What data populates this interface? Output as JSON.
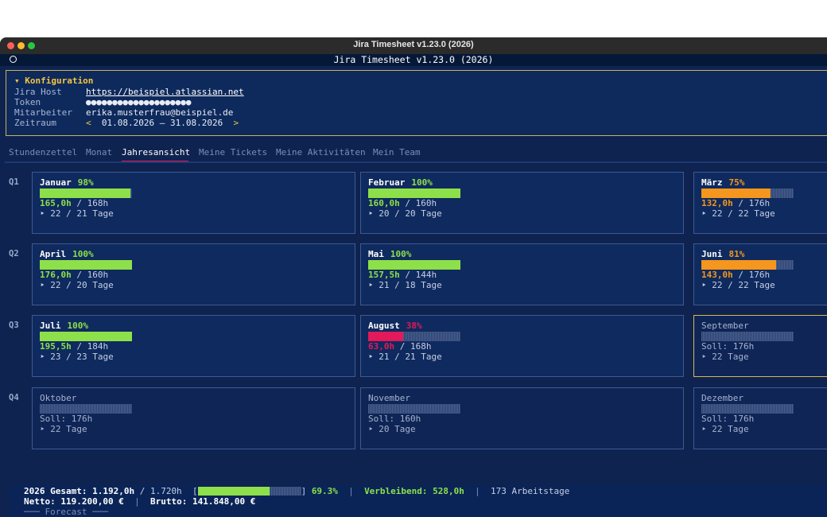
{
  "window": {
    "title": "Jira Timesheet v1.23.0 (2026)"
  },
  "app": {
    "title": "Jira Timesheet v1.23.0 (2026)"
  },
  "config": {
    "heading": "▾ Konfiguration",
    "rows": [
      {
        "label": "Jira Host",
        "value": "https://beispiel.atlassian.net"
      },
      {
        "label": "Token",
        "value": "●●●●●●●●●●●●●●●●●●●●"
      },
      {
        "label": "Mitarbeiter",
        "value": "erika.musterfrau@beispiel.de"
      },
      {
        "label": "Zeitraum",
        "value": "01.08.2026 – 31.08.2026",
        "prev": "<",
        "next": ">"
      }
    ]
  },
  "tabs": [
    "Stundenzettel",
    "Monat",
    "Jahresansicht",
    "Meine Tickets",
    "Meine Aktivitäten",
    "Mein Team"
  ],
  "active_tab": "Jahresansicht",
  "colors": {
    "green": "#8de04a",
    "orange": "#f5961e",
    "pink": "#e2195b",
    "accent_yellow": "#f5c542",
    "background": "#0e2350"
  },
  "quarters": [
    "Q1",
    "Q2",
    "Q3",
    "Q4"
  ],
  "months": [
    {
      "name": "Januar",
      "pct": "98%",
      "progress": 0.98,
      "status": "green",
      "ist": "165,0h",
      "soll": "/ 168h",
      "days": "‣ 22 / 21 Tage"
    },
    {
      "name": "Februar",
      "pct": "100%",
      "progress": 1.0,
      "status": "green",
      "ist": "160,0h",
      "soll": "/ 160h",
      "days": "‣ 20 / 20 Tage"
    },
    {
      "name": "März",
      "pct": "75%",
      "progress": 0.75,
      "status": "orange",
      "ist": "132,0h",
      "soll": "/ 176h",
      "days": "‣ 22 / 22 Tage"
    },
    {
      "name": "April",
      "pct": "100%",
      "progress": 1.0,
      "status": "green",
      "ist": "176,0h",
      "soll": "/ 160h",
      "days": "‣ 22 / 20 Tage"
    },
    {
      "name": "Mai",
      "pct": "100%",
      "progress": 1.0,
      "status": "green",
      "ist": "157,5h",
      "soll": "/ 144h",
      "days": "‣ 21 / 18 Tage"
    },
    {
      "name": "Juni",
      "pct": "81%",
      "progress": 0.81,
      "status": "orange",
      "ist": "143,0h",
      "soll": "/ 176h",
      "days": "‣ 22 / 22 Tage"
    },
    {
      "name": "Juli",
      "pct": "100%",
      "progress": 1.0,
      "status": "green",
      "ist": "195,5h",
      "soll": "/ 184h",
      "days": "‣ 23 / 23 Tage"
    },
    {
      "name": "August",
      "pct": "38%",
      "progress": 0.38,
      "status": "pink",
      "ist": "63,0h",
      "soll": "/ 168h",
      "days": "‣ 21 / 21 Tage"
    },
    {
      "name": "September",
      "pct": "",
      "progress": 0,
      "status": "future",
      "current": true,
      "ist": "",
      "soll": "Soll: 176h",
      "days": "‣ 22 Tage"
    },
    {
      "name": "Oktober",
      "pct": "",
      "progress": 0,
      "status": "future",
      "ist": "",
      "soll": "Soll: 176h",
      "days": "‣ 22 Tage"
    },
    {
      "name": "November",
      "pct": "",
      "progress": 0,
      "status": "future",
      "ist": "",
      "soll": "Soll: 160h",
      "days": "‣ 20 Tage"
    },
    {
      "name": "Dezember",
      "pct": "",
      "progress": 0,
      "status": "future",
      "ist": "",
      "soll": "Soll: 176h",
      "days": "‣ 22 Tage"
    }
  ],
  "footer": {
    "total_label": "2026 Gesamt: 1.192,0h",
    "total_target": "/ 1.720h",
    "bar_open": "[",
    "bar_close": "]",
    "progress": 0.693,
    "percent": "69.3%",
    "remaining": "Verbleibend: 528,0h",
    "workdays": "173 Arbeitstage",
    "separator": "|",
    "netto": "Netto: 119.200,00 €",
    "brutto": "Brutto: 141.848,00 €",
    "forecast": "─── Forecast ───"
  }
}
